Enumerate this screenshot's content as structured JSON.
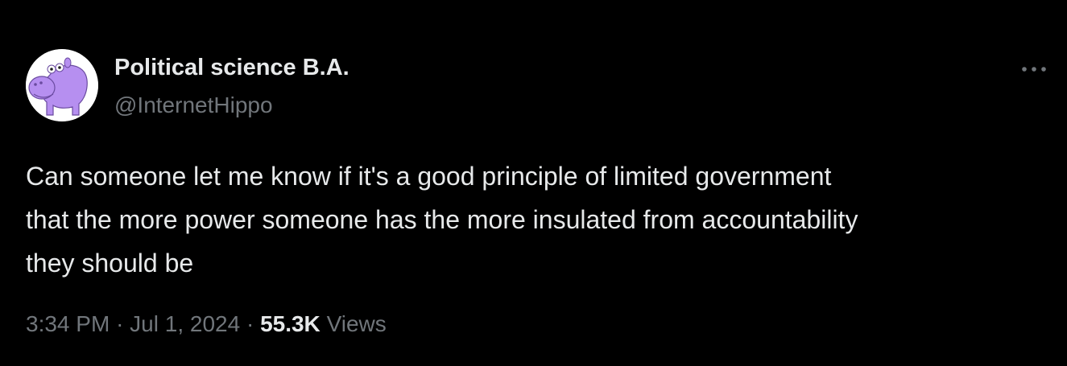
{
  "author": {
    "display_name": "Political science B.A.",
    "handle": "@InternetHippo",
    "avatar_icon": "hippo-avatar-icon",
    "avatar_color": "#b68ff0"
  },
  "more_icon": "more-horizontal-icon",
  "tweet": {
    "text": "Can someone let me know if it's a good principle of limited government\nthat the more power someone has the more insulated from accountability\nthey should be"
  },
  "meta": {
    "time": "3:34 PM",
    "separator": "·",
    "date": "Jul 1, 2024",
    "views_count": "55.3K",
    "views_label": "Views"
  },
  "colors": {
    "background": "#000000",
    "primary_text": "#e7e9ea",
    "secondary_text": "#71767b"
  }
}
